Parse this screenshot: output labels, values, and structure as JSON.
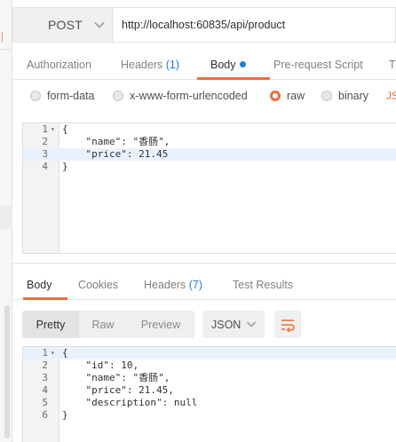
{
  "request": {
    "method": "POST",
    "url": "http://localhost:60835/api/product"
  },
  "request_tabs": [
    {
      "label": "Authorization"
    },
    {
      "label": "Headers",
      "count": "(1)"
    },
    {
      "label": "Body"
    },
    {
      "label": "Pre-request Script"
    },
    {
      "label": "T"
    }
  ],
  "body_modes": {
    "form_data": "form-data",
    "urlencoded": "x-www-form-urlencoded",
    "raw": "raw",
    "binary": "binary",
    "type_hint": "JS"
  },
  "request_body": {
    "lines": [
      {
        "num": "1",
        "fold": "▾",
        "code": "{"
      },
      {
        "num": "2",
        "code": "    \"name\": \"香肠\","
      },
      {
        "num": "3",
        "code": "    \"price\": 21.45"
      },
      {
        "num": "4",
        "code": "}"
      }
    ]
  },
  "response_tabs": [
    {
      "label": "Body"
    },
    {
      "label": "Cookies"
    },
    {
      "label": "Headers",
      "count": "(7)"
    },
    {
      "label": "Test Results"
    }
  ],
  "format_toolbar": {
    "pretty": "Pretty",
    "raw": "Raw",
    "preview": "Preview",
    "language": "JSON"
  },
  "response_body": {
    "lines": [
      {
        "num": "1",
        "fold": "▾",
        "code": "{"
      },
      {
        "num": "2",
        "code": "    \"id\": 10,"
      },
      {
        "num": "3",
        "code": "    \"name\": \"香肠\","
      },
      {
        "num": "4",
        "code": "    \"price\": 21.45,"
      },
      {
        "num": "5",
        "code": "    \"description\": null"
      },
      {
        "num": "6",
        "code": "}"
      }
    ]
  },
  "colors": {
    "accent": "#f26b3a",
    "link": "#1e7fd6",
    "active_line": "#e8f2ff"
  },
  "icons": {
    "method_dropdown": "chevron-down-icon",
    "language_dropdown": "chevron-down-icon",
    "wrap": "wrap-lines-icon"
  }
}
